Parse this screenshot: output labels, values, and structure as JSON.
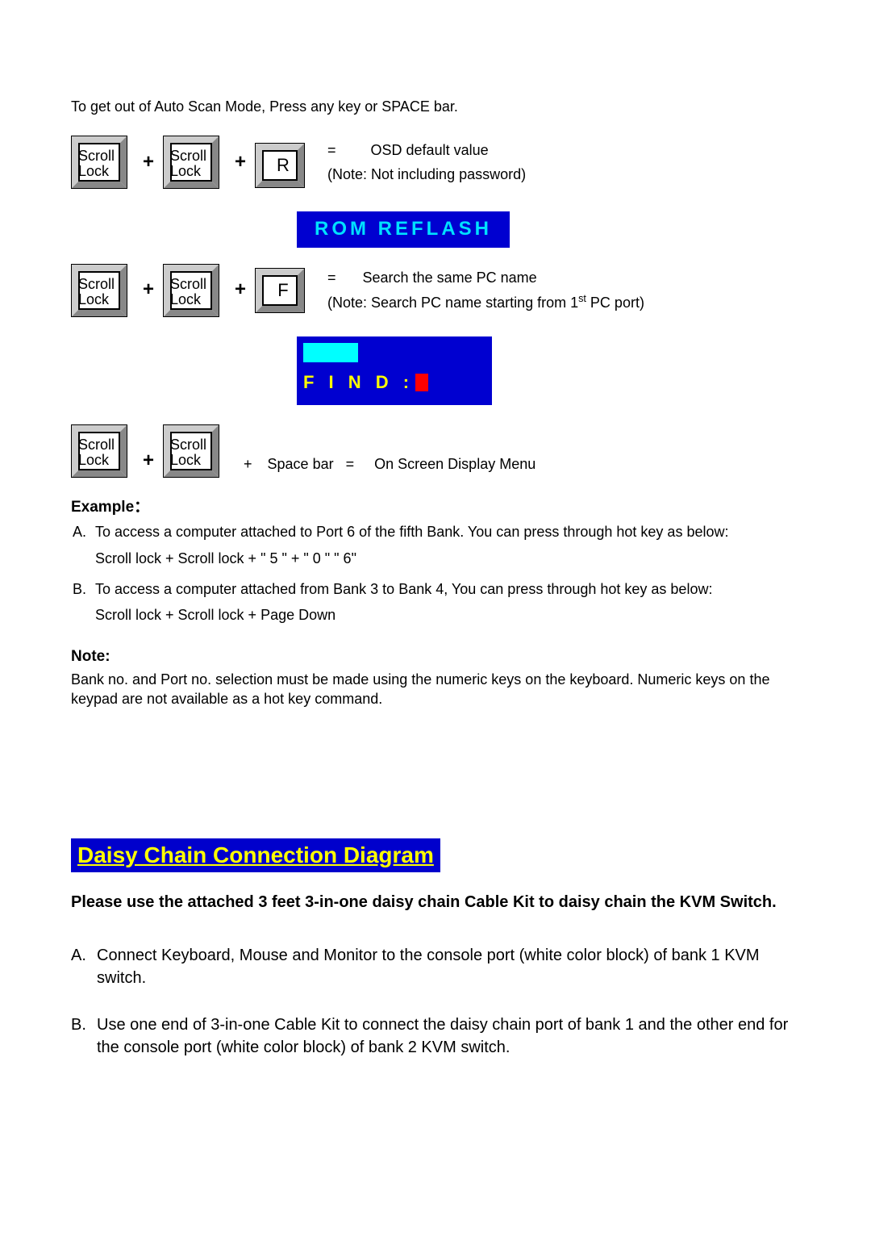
{
  "intro": "To get out of Auto Scan Mode, Press any key or SPACE bar.",
  "kScroll": "Scroll Lock",
  "plus": "+",
  "kR": "R",
  "kF": "F",
  "eq": "=",
  "space": "Space bar",
  "row1": {
    "result": "OSD default value",
    "note": "(Note: Not including password)"
  },
  "romBar": "ROM    REFLASH",
  "row2": {
    "result": "Search the same PC name",
    "note_a": "(Note: Search PC name starting from 1",
    "note_sup": "st",
    "note_b": " PC port)"
  },
  "findLabel": "F I N D :",
  "row3": {
    "result": "On Screen Display Menu"
  },
  "exampleHead": "Example：",
  "exA_lbl": "A.",
  "exA_txt": "To access a computer attached to Port 6 of the fifth Bank. You can press through hot key as below:",
  "exA_sub": "Scroll lock + Scroll lock + \" 5 \" + \" 0 \"    \" 6\"",
  "exB_lbl": "B.",
  "exB_txt": "To access a computer attached from Bank 3 to Bank 4, You can press through hot key as below:",
  "exB_sub": "Scroll lock + Scroll lock + Page Down",
  "noteHead": "Note:",
  "noteBody": "Bank no. and Port no. selection must be made using the numeric keys on the keyboard. Numeric keys on the keypad are not available as a hot key command.",
  "bigHead": "Daisy Chain Connection Diagram",
  "subHead": "Please use the attached 3 feet 3-in-one daisy chain Cable Kit to daisy chain the KVM Switch.",
  "stepA_lbl": "A.",
  "stepA_txt": "Connect Keyboard, Mouse and Monitor to the console port (white color block) of bank 1 KVM switch.",
  "stepB_lbl": "B.",
  "stepB_txt": "Use one end of 3-in-one Cable Kit to connect the daisy chain port of bank 1 and the other end for the console port (white color block) of bank 2 KVM switch."
}
